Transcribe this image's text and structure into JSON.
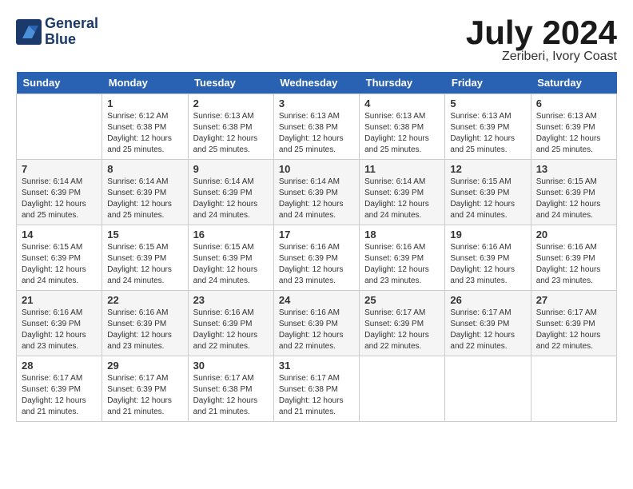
{
  "header": {
    "logo_line1": "General",
    "logo_line2": "Blue",
    "month": "July 2024",
    "location": "Zeriberi, Ivory Coast"
  },
  "days_of_week": [
    "Sunday",
    "Monday",
    "Tuesday",
    "Wednesday",
    "Thursday",
    "Friday",
    "Saturday"
  ],
  "weeks": [
    [
      {
        "day": "",
        "sunrise": "",
        "sunset": "",
        "daylight": ""
      },
      {
        "day": "1",
        "sunrise": "Sunrise: 6:12 AM",
        "sunset": "Sunset: 6:38 PM",
        "daylight": "Daylight: 12 hours and 25 minutes."
      },
      {
        "day": "2",
        "sunrise": "Sunrise: 6:13 AM",
        "sunset": "Sunset: 6:38 PM",
        "daylight": "Daylight: 12 hours and 25 minutes."
      },
      {
        "day": "3",
        "sunrise": "Sunrise: 6:13 AM",
        "sunset": "Sunset: 6:38 PM",
        "daylight": "Daylight: 12 hours and 25 minutes."
      },
      {
        "day": "4",
        "sunrise": "Sunrise: 6:13 AM",
        "sunset": "Sunset: 6:38 PM",
        "daylight": "Daylight: 12 hours and 25 minutes."
      },
      {
        "day": "5",
        "sunrise": "Sunrise: 6:13 AM",
        "sunset": "Sunset: 6:39 PM",
        "daylight": "Daylight: 12 hours and 25 minutes."
      },
      {
        "day": "6",
        "sunrise": "Sunrise: 6:13 AM",
        "sunset": "Sunset: 6:39 PM",
        "daylight": "Daylight: 12 hours and 25 minutes."
      }
    ],
    [
      {
        "day": "7",
        "sunrise": "Sunrise: 6:14 AM",
        "sunset": "Sunset: 6:39 PM",
        "daylight": "Daylight: 12 hours and 25 minutes."
      },
      {
        "day": "8",
        "sunrise": "Sunrise: 6:14 AM",
        "sunset": "Sunset: 6:39 PM",
        "daylight": "Daylight: 12 hours and 25 minutes."
      },
      {
        "day": "9",
        "sunrise": "Sunrise: 6:14 AM",
        "sunset": "Sunset: 6:39 PM",
        "daylight": "Daylight: 12 hours and 24 minutes."
      },
      {
        "day": "10",
        "sunrise": "Sunrise: 6:14 AM",
        "sunset": "Sunset: 6:39 PM",
        "daylight": "Daylight: 12 hours and 24 minutes."
      },
      {
        "day": "11",
        "sunrise": "Sunrise: 6:14 AM",
        "sunset": "Sunset: 6:39 PM",
        "daylight": "Daylight: 12 hours and 24 minutes."
      },
      {
        "day": "12",
        "sunrise": "Sunrise: 6:15 AM",
        "sunset": "Sunset: 6:39 PM",
        "daylight": "Daylight: 12 hours and 24 minutes."
      },
      {
        "day": "13",
        "sunrise": "Sunrise: 6:15 AM",
        "sunset": "Sunset: 6:39 PM",
        "daylight": "Daylight: 12 hours and 24 minutes."
      }
    ],
    [
      {
        "day": "14",
        "sunrise": "Sunrise: 6:15 AM",
        "sunset": "Sunset: 6:39 PM",
        "daylight": "Daylight: 12 hours and 24 minutes."
      },
      {
        "day": "15",
        "sunrise": "Sunrise: 6:15 AM",
        "sunset": "Sunset: 6:39 PM",
        "daylight": "Daylight: 12 hours and 24 minutes."
      },
      {
        "day": "16",
        "sunrise": "Sunrise: 6:15 AM",
        "sunset": "Sunset: 6:39 PM",
        "daylight": "Daylight: 12 hours and 24 minutes."
      },
      {
        "day": "17",
        "sunrise": "Sunrise: 6:16 AM",
        "sunset": "Sunset: 6:39 PM",
        "daylight": "Daylight: 12 hours and 23 minutes."
      },
      {
        "day": "18",
        "sunrise": "Sunrise: 6:16 AM",
        "sunset": "Sunset: 6:39 PM",
        "daylight": "Daylight: 12 hours and 23 minutes."
      },
      {
        "day": "19",
        "sunrise": "Sunrise: 6:16 AM",
        "sunset": "Sunset: 6:39 PM",
        "daylight": "Daylight: 12 hours and 23 minutes."
      },
      {
        "day": "20",
        "sunrise": "Sunrise: 6:16 AM",
        "sunset": "Sunset: 6:39 PM",
        "daylight": "Daylight: 12 hours and 23 minutes."
      }
    ],
    [
      {
        "day": "21",
        "sunrise": "Sunrise: 6:16 AM",
        "sunset": "Sunset: 6:39 PM",
        "daylight": "Daylight: 12 hours and 23 minutes."
      },
      {
        "day": "22",
        "sunrise": "Sunrise: 6:16 AM",
        "sunset": "Sunset: 6:39 PM",
        "daylight": "Daylight: 12 hours and 23 minutes."
      },
      {
        "day": "23",
        "sunrise": "Sunrise: 6:16 AM",
        "sunset": "Sunset: 6:39 PM",
        "daylight": "Daylight: 12 hours and 22 minutes."
      },
      {
        "day": "24",
        "sunrise": "Sunrise: 6:16 AM",
        "sunset": "Sunset: 6:39 PM",
        "daylight": "Daylight: 12 hours and 22 minutes."
      },
      {
        "day": "25",
        "sunrise": "Sunrise: 6:17 AM",
        "sunset": "Sunset: 6:39 PM",
        "daylight": "Daylight: 12 hours and 22 minutes."
      },
      {
        "day": "26",
        "sunrise": "Sunrise: 6:17 AM",
        "sunset": "Sunset: 6:39 PM",
        "daylight": "Daylight: 12 hours and 22 minutes."
      },
      {
        "day": "27",
        "sunrise": "Sunrise: 6:17 AM",
        "sunset": "Sunset: 6:39 PM",
        "daylight": "Daylight: 12 hours and 22 minutes."
      }
    ],
    [
      {
        "day": "28",
        "sunrise": "Sunrise: 6:17 AM",
        "sunset": "Sunset: 6:39 PM",
        "daylight": "Daylight: 12 hours and 21 minutes."
      },
      {
        "day": "29",
        "sunrise": "Sunrise: 6:17 AM",
        "sunset": "Sunset: 6:39 PM",
        "daylight": "Daylight: 12 hours and 21 minutes."
      },
      {
        "day": "30",
        "sunrise": "Sunrise: 6:17 AM",
        "sunset": "Sunset: 6:38 PM",
        "daylight": "Daylight: 12 hours and 21 minutes."
      },
      {
        "day": "31",
        "sunrise": "Sunrise: 6:17 AM",
        "sunset": "Sunset: 6:38 PM",
        "daylight": "Daylight: 12 hours and 21 minutes."
      },
      {
        "day": "",
        "sunrise": "",
        "sunset": "",
        "daylight": ""
      },
      {
        "day": "",
        "sunrise": "",
        "sunset": "",
        "daylight": ""
      },
      {
        "day": "",
        "sunrise": "",
        "sunset": "",
        "daylight": ""
      }
    ]
  ]
}
